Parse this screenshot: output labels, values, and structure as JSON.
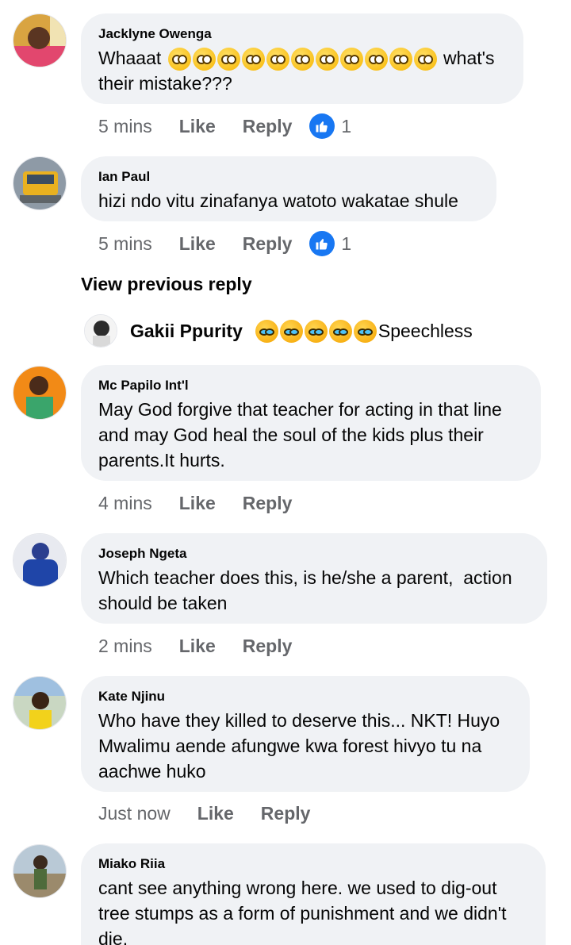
{
  "comments": [
    {
      "author": "Jacklyne Owenga",
      "text_before": "Whaaat",
      "text_after": "what's",
      "text_line2": "their mistake???",
      "time": "5 mins",
      "like": "Like",
      "reply": "Reply",
      "reactions": "1"
    },
    {
      "author": "Ian Paul",
      "text": "hizi ndo vitu zinafanya watoto wakatae shule",
      "time": "5 mins",
      "like": "Like",
      "reply": "Reply",
      "reactions": "1"
    },
    {
      "author": "Mc Papilo Int'l",
      "line1": "May God forgive that teacher for acting in that line",
      "line2": "and may God heal the soul of the kids plus their",
      "line3": "parents.It hurts.",
      "time": "4 mins",
      "like": "Like",
      "reply": "Reply"
    },
    {
      "author": "Joseph Ngeta",
      "line1": "Which teacher does this, is he/she a parent,  action",
      "line2": "should be taken",
      "time": "2 mins",
      "like": "Like",
      "reply": "Reply"
    },
    {
      "author": "Kate Njinu",
      "line1": "Who have they killed to deserve this... NKT! Huyo",
      "line2": "Mwalimu aende afungwe kwa forest hivyo tu na",
      "line3": "aachwe huko",
      "time": "Just now",
      "like": "Like",
      "reply": "Reply"
    },
    {
      "author": "Miako Riia",
      "line1": "cant see anything wrong here. we used to dig-out",
      "line2": "tree stumps as a form of punishment and we didn't",
      "line3": "die."
    }
  ],
  "view_previous": "View previous reply",
  "reply_preview": {
    "author": "Gakii Ppurity",
    "text": "Speechless"
  },
  "colors": {
    "bubble": "#f0f2f5",
    "muted": "#65676b",
    "like_blue": "#1877f2"
  },
  "icons": [
    "avatar",
    "like-reaction-icon",
    "flushed-face-emoji",
    "crying-face-emoji"
  ]
}
